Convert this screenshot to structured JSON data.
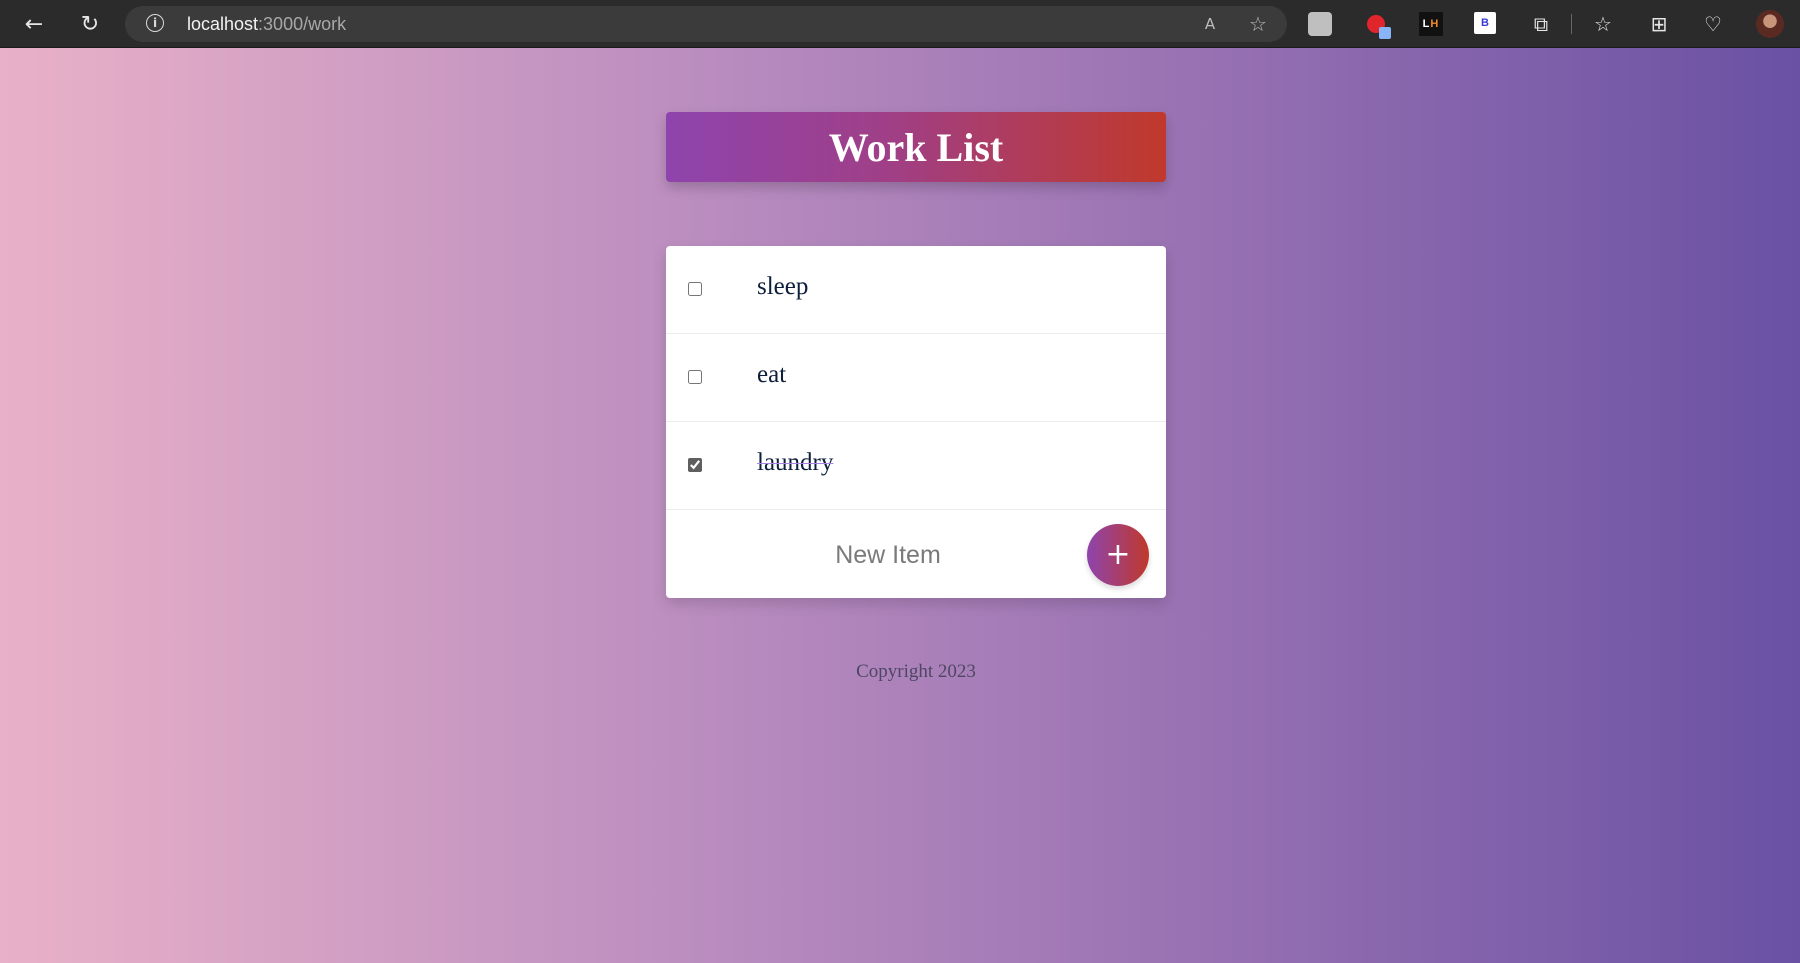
{
  "browser": {
    "url_host": "localhost",
    "url_path": ":3000/work",
    "back_icon": "←",
    "reload_icon": "↻",
    "info_icon": "i",
    "read_aloud_icon": "A",
    "add_favorite_icon": "☆",
    "ext_l": "L",
    "ext_h": "H",
    "ext_b": "B",
    "extensions_icon": "⧉",
    "favorites_icon": "☆",
    "collections_icon": "⊞",
    "health_icon": "♡"
  },
  "page": {
    "heading": "Work List",
    "items": [
      {
        "label": "sleep",
        "checked": false
      },
      {
        "label": "eat",
        "checked": false
      },
      {
        "label": "laundry",
        "checked": true
      }
    ],
    "new_item_placeholder": "New Item",
    "add_button_label": "+",
    "footer": "Copyright 2023"
  },
  "colors": {
    "heading_gradient": [
      "#8e44ad",
      "#c0392b"
    ],
    "background_gradient": [
      "#e9b1c8",
      "#6a51a3"
    ],
    "item_text": "#0c1e3a",
    "strike": "#a683e3"
  }
}
